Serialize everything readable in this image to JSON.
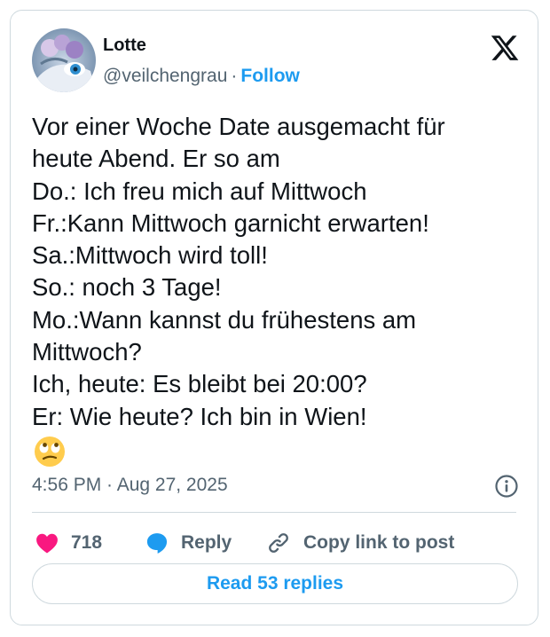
{
  "author": {
    "name": "Lotte",
    "handle": "@veilchengrau",
    "separator": "·",
    "follow_label": "Follow"
  },
  "post": {
    "lines": [
      "Vor einer Woche Date ausgemacht für",
      "heute Abend. Er so am",
      "Do.: Ich freu mich auf Mittwoch",
      "Fr.:Kann Mittwoch garnicht erwarten!",
      "Sa.:Mittwoch wird toll!",
      "So.: noch 3 Tage!",
      "Mo.:Wann kannst du frühestens am",
      "Mittwoch?",
      "Ich, heute: Es bleibt bei 20:00?",
      "Er: Wie heute? Ich bin in Wien!"
    ],
    "emoji": "🙄",
    "timestamp": "4:56 PM · Aug 27, 2025"
  },
  "actions": {
    "like_count": "718",
    "reply_label": "Reply",
    "copy_label": "Copy link to post",
    "read_replies_label": "Read 53 replies"
  },
  "colors": {
    "accent": "#1d9bf0",
    "like": "#f91880",
    "muted": "#536471",
    "border": "#cfd9de"
  },
  "icons": {
    "brand": "x-logo-icon",
    "info": "info-icon",
    "like": "heart-icon",
    "reply": "speech-bubble-icon",
    "copy": "link-icon"
  }
}
